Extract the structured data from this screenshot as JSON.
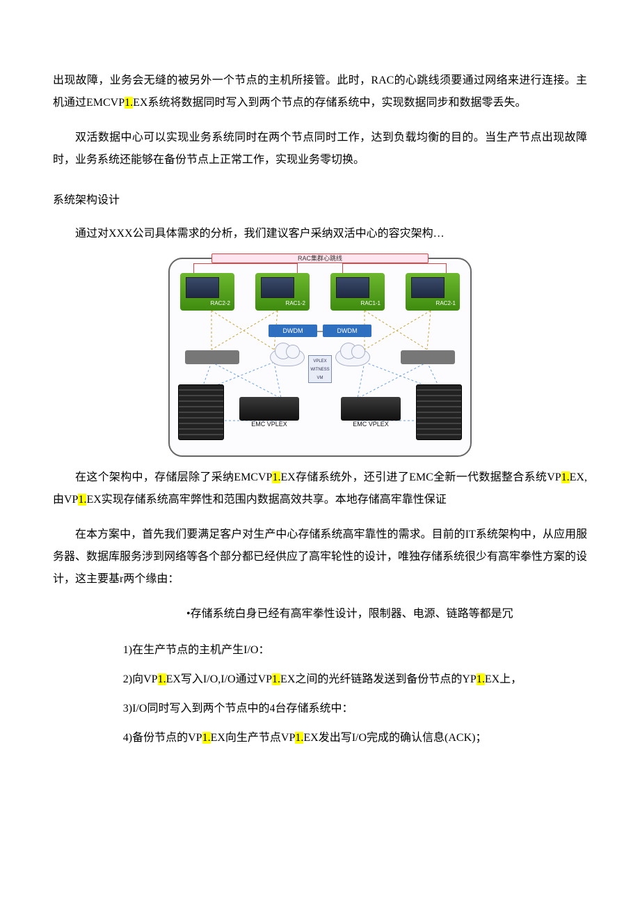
{
  "p1": {
    "a": "出现故障，业务会无缝的被另外一个节点的主机所接管。此时，RAC的心跳线须要通过网络来进行连接。主机通过EMCVP",
    "hl": "1.",
    "b": "EX系统将数据同时写入到两个节点的存储系统中，实现数据同步和数据零丢失。"
  },
  "p2": "双活数据中心可以实现业务系统同时在两个节点同时工作，达到负载均衡的目的。当生产节点出现故障时，业务系统还能够在备份节点上正常工作，实现业务零切换。",
  "h1": "系统架构设计",
  "p3": "通过对XXX公司具体需求的分析，我们建议客户采纳双活中心的容灾架构…",
  "diagram": {
    "top": "RAC集群心跳线",
    "rac": [
      "RAC2-2",
      "RAC1-2",
      "RAC1-1",
      "RAC2-1"
    ],
    "dwdm": "DWDM",
    "witness": "VPLEX WITNESS VM",
    "vplex": "EMC VPLEX"
  },
  "p4": {
    "a": "在这个架构中，存储层除了采纳EMCVP",
    "h1": "1.",
    "b": "EX存储系统外，还引进了EMC全新一代数据整合系统VP",
    "h2": "1.",
    "c": "EX,由VP",
    "h3": "1.",
    "d": "EX实现存储系统高牢弊性和范围内数据高效共享。本地存储高牢靠性保证"
  },
  "p5": "在本方案中，首先我们要满足客户对生产中心存储系统高牢靠性的需求。目前的IT系统架构中，从应用服务器、数据库服务涉到网络等各个部分都已经供应了高牢轮性的设计，唯独存储系统很少有高牢拳性方案的设计，这主要基r两个缘由：",
  "bullet": "•存储系统白身已经有高牢拳性设计，限制器、电源、链路等都是冗",
  "l1": "1)在生产节点的主机产生I/O：",
  "l2": {
    "a": "2)向VP",
    "h1": "1.",
    "b": "EX写入I/O,I/O通过VP",
    "h2": "1.",
    "c": "EX之间的光纤链路发送到备份节点的YP",
    "h3": "1.",
    "d": "EX上，"
  },
  "l3": "3)I/O同时写入到两个节点中的4台存储系统中：",
  "l4": {
    "a": "4)备份节点的VP",
    "h1": "1.",
    "b": "EX向生产节点VP",
    "h2": "1.",
    "c": "EX发出写I/O完成的确认信息(ACK)；"
  }
}
